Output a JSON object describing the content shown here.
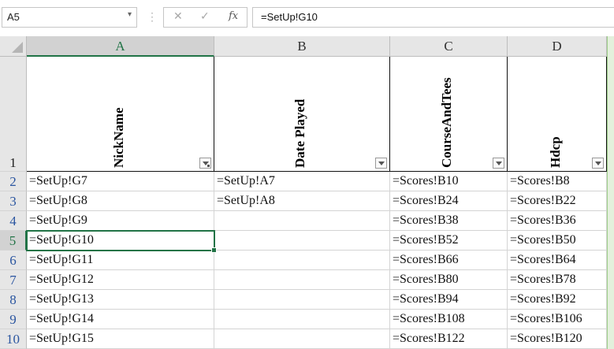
{
  "formula_bar": {
    "name_box": "A5",
    "cancel_icon": "✕",
    "enter_icon": "✓",
    "fx_label": "fx",
    "formula": "=SetUp!G10"
  },
  "columns": [
    {
      "letter": "A",
      "header": "NickName",
      "filter_active": true
    },
    {
      "letter": "B",
      "header": "Date Played",
      "filter_active": false
    },
    {
      "letter": "C",
      "header": "CourseAndTees",
      "filter_active": false
    },
    {
      "letter": "D",
      "header": "Hdcp",
      "filter_active": false
    }
  ],
  "rows": [
    {
      "num": "1"
    },
    {
      "num": "2",
      "A": "=SetUp!G7",
      "B": "=SetUp!A7",
      "C": "=Scores!B10",
      "D": "=Scores!B8"
    },
    {
      "num": "3",
      "A": "=SetUp!G8",
      "B": "=SetUp!A8",
      "C": "=Scores!B24",
      "D": "=Scores!B22"
    },
    {
      "num": "4",
      "A": "=SetUp!G9",
      "B": "",
      "C": "=Scores!B38",
      "D": "=Scores!B36"
    },
    {
      "num": "5",
      "A": "=SetUp!G10",
      "B": "",
      "C": "=Scores!B52",
      "D": "=Scores!B50"
    },
    {
      "num": "6",
      "A": "=SetUp!G11",
      "B": "",
      "C": "=Scores!B66",
      "D": "=Scores!B64"
    },
    {
      "num": "7",
      "A": "=SetUp!G12",
      "B": "",
      "C": "=Scores!B80",
      "D": "=Scores!B78"
    },
    {
      "num": "8",
      "A": "=SetUp!G13",
      "B": "",
      "C": "=Scores!B94",
      "D": "=Scores!B92"
    },
    {
      "num": "9",
      "A": "=SetUp!G14",
      "B": "",
      "C": "=Scores!B108",
      "D": "=Scores!B106"
    },
    {
      "num": "10",
      "A": "=SetUp!G15",
      "B": "",
      "C": "=Scores!B122",
      "D": "=Scores!B120"
    }
  ],
  "selected_cell": "A5",
  "colors": {
    "selection": "#217346",
    "header_bg": "#e6e6e6"
  }
}
